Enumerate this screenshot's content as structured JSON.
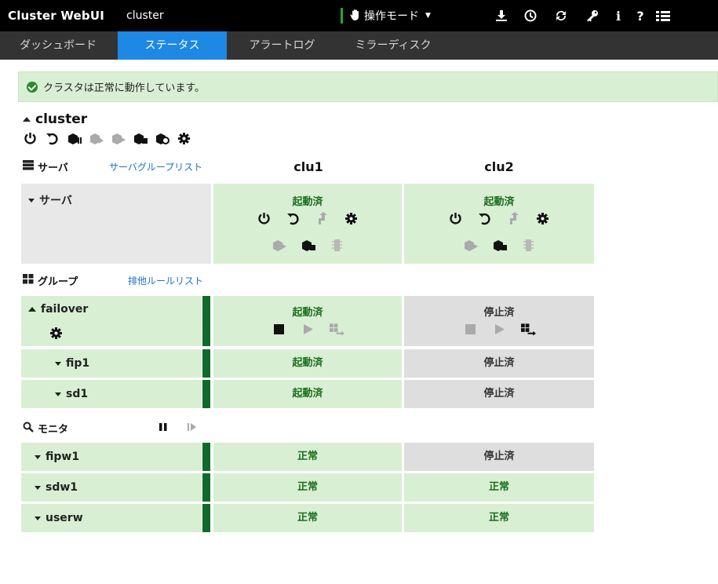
{
  "app": {
    "title": "Cluster WebUI",
    "cluster_name": "cluster"
  },
  "toolbar": {
    "mode_label": "操作モード"
  },
  "tabs": [
    {
      "label": "ダッシュボード"
    },
    {
      "label": "ステータス"
    },
    {
      "label": "アラートログ"
    },
    {
      "label": "ミラーディスク"
    }
  ],
  "status_banner": "クラスタは正常に動作しています。",
  "cluster": {
    "name": "cluster"
  },
  "servers_section": {
    "title": "サーバ",
    "link": "サーバグループリスト"
  },
  "columns": [
    "clu1",
    "clu2"
  ],
  "server_row": {
    "label": "サーバ",
    "statuses": [
      "起動済",
      "起動済"
    ]
  },
  "groups_section": {
    "title": "グループ",
    "link": "排他ルールリスト"
  },
  "groups": [
    {
      "name": "failover",
      "statuses": [
        "起動済",
        "停止済"
      ]
    },
    {
      "name": "fip1",
      "statuses": [
        "起動済",
        "停止済"
      ]
    },
    {
      "name": "sd1",
      "statuses": [
        "起動済",
        "停止済"
      ]
    }
  ],
  "monitors_section": {
    "title": "モニタ"
  },
  "monitors": [
    {
      "name": "fipw1",
      "statuses": [
        "正常",
        "停止済"
      ]
    },
    {
      "name": "sdw1",
      "statuses": [
        "正常",
        "正常"
      ]
    },
    {
      "name": "userw",
      "statuses": [
        "正常",
        "正常"
      ]
    }
  ],
  "colors": {
    "topbar": "#000000",
    "tabs_bg": "#333333",
    "active_tab": "#1e88e5",
    "ok_green_bg": "#d9efd4",
    "stopped_gray_bg": "#dedede",
    "status_bar": "#0f6b2a",
    "status_text_green": "#1b6e1b"
  }
}
